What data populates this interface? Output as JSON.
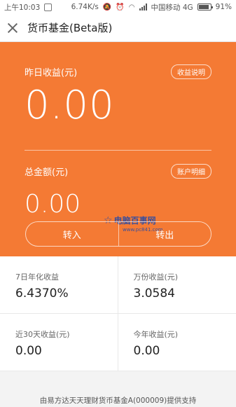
{
  "status": {
    "time": "上午10:03",
    "speed": "6.74K/s",
    "carrier": "中国移动 4G",
    "battery": "91%",
    "battery_level": 0.91
  },
  "header": {
    "title": "货币基金(Beta版)"
  },
  "hero": {
    "yesterday_label": "昨日收益(元)",
    "yesterday_help": "收益说明",
    "yesterday_value": "0.00",
    "total_label": "总金额(元)",
    "total_detail": "账户明细",
    "total_value": "0.00",
    "transfer_in": "转入",
    "transfer_out": "转出",
    "watermark": "电脑百事网",
    "watermark_url": "www.pc841.com"
  },
  "stats": [
    {
      "label": "7日年化收益",
      "value": "6.4370%"
    },
    {
      "label": "万份收益(元)",
      "value": "3.0584"
    },
    {
      "label": "近30天收益(元)",
      "value": "0.00"
    },
    {
      "label": "今年收益(元)",
      "value": "0.00"
    }
  ],
  "footer": {
    "text": "由易方达天天理财货币基金A(000009)提供支持"
  },
  "colors": {
    "accent": "#f47a34",
    "background": "#f3f3f3"
  }
}
